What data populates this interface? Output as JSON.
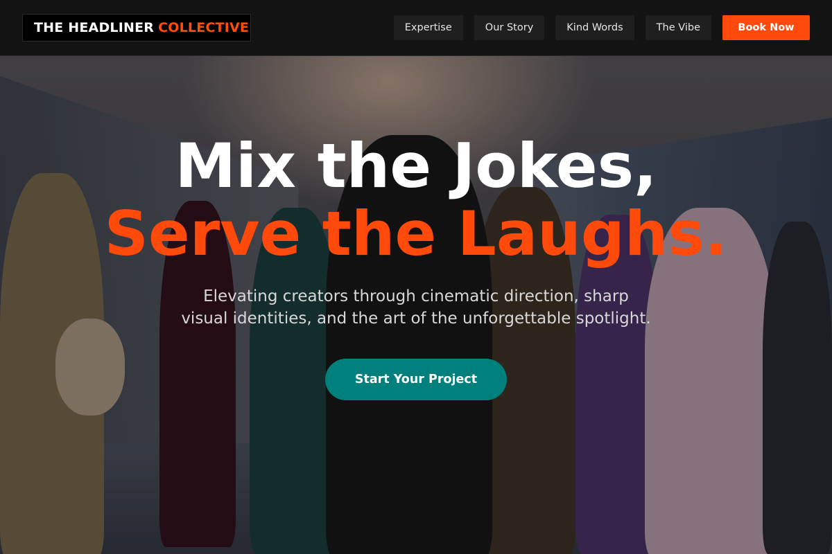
{
  "brand": {
    "name_part_1": "THE HEADLINER",
    "name_part_2": "COLLECTIVE",
    "accent_color": "#ff4a0c"
  },
  "nav": {
    "items": [
      {
        "label": "Expertise"
      },
      {
        "label": "Our Story"
      },
      {
        "label": "Kind Words"
      },
      {
        "label": "The Vibe"
      }
    ],
    "book_label": "Book Now"
  },
  "hero": {
    "headline_line_1": "Mix the Jokes,",
    "headline_line_2": "Serve the Laughs.",
    "subtitle": "Elevating creators through cinematic direction, sharp visual identities, and the art of the unforgettable spotlight.",
    "cta_label": "Start Your Project",
    "cta_color": "#00807d",
    "background": "photo of a group of people in fashionable outfits standing in a studio"
  }
}
